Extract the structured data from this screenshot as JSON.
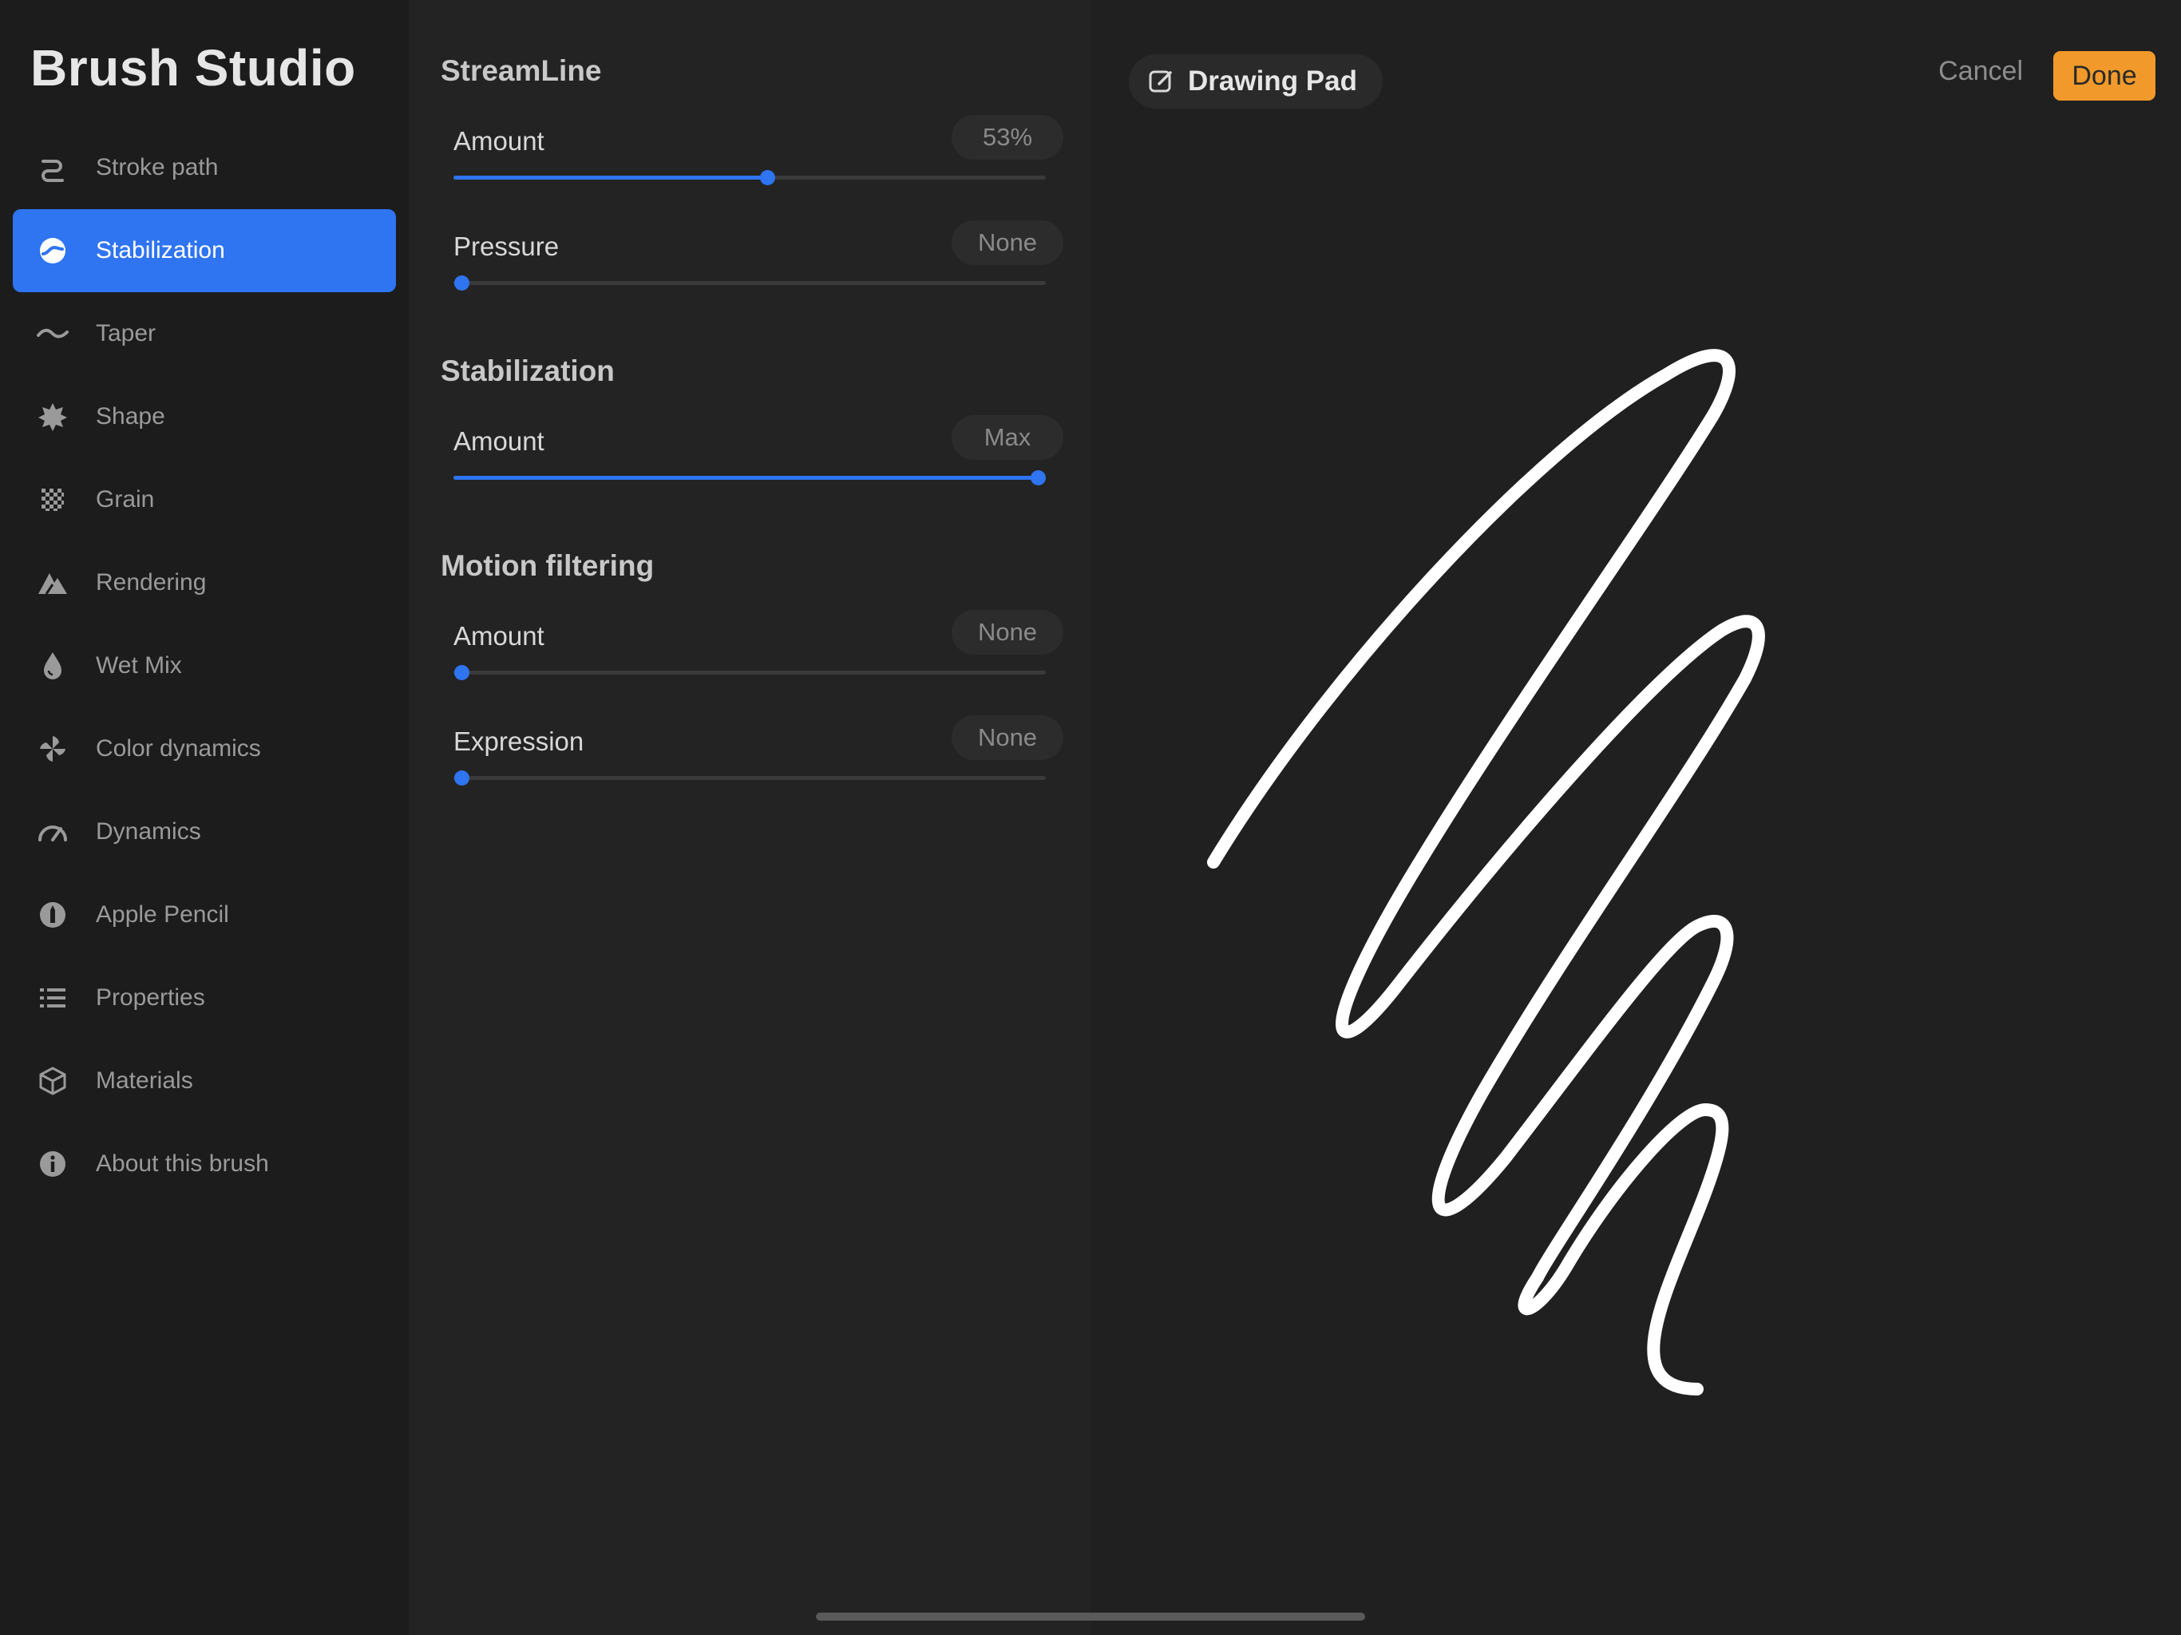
{
  "sidebar": {
    "title": "Brush Studio",
    "items": [
      {
        "label": "Stroke path",
        "icon": "stroke-path-icon",
        "active": false
      },
      {
        "label": "Stabilization",
        "icon": "stabilization-icon",
        "active": true
      },
      {
        "label": "Taper",
        "icon": "taper-icon",
        "active": false
      },
      {
        "label": "Shape",
        "icon": "shape-icon",
        "active": false
      },
      {
        "label": "Grain",
        "icon": "grain-icon",
        "active": false
      },
      {
        "label": "Rendering",
        "icon": "rendering-icon",
        "active": false
      },
      {
        "label": "Wet Mix",
        "icon": "wet-mix-icon",
        "active": false
      },
      {
        "label": "Color dynamics",
        "icon": "color-dynamics-icon",
        "active": false
      },
      {
        "label": "Dynamics",
        "icon": "dynamics-icon",
        "active": false
      },
      {
        "label": "Apple Pencil",
        "icon": "apple-pencil-icon",
        "active": false
      },
      {
        "label": "Properties",
        "icon": "properties-icon",
        "active": false
      },
      {
        "label": "Materials",
        "icon": "materials-icon",
        "active": false
      },
      {
        "label": "About this brush",
        "icon": "info-icon",
        "active": false
      }
    ]
  },
  "settings": {
    "streamline": {
      "title": "StreamLine",
      "amount": {
        "label": "Amount",
        "value": "53%",
        "fraction": 0.53
      },
      "pressure": {
        "label": "Pressure",
        "value": "None",
        "fraction": 0.0
      }
    },
    "stabilization": {
      "title": "Stabilization",
      "amount": {
        "label": "Amount",
        "value": "Max",
        "fraction": 1.0
      }
    },
    "motion": {
      "title": "Motion filtering",
      "amount": {
        "label": "Amount",
        "value": "None",
        "fraction": 0.0
      },
      "expression": {
        "label": "Expression",
        "value": "None",
        "fraction": 0.0
      }
    }
  },
  "pad": {
    "title": "Drawing Pad",
    "cancel": "Cancel",
    "done": "Done"
  },
  "colors": {
    "accent": "#2f74f0",
    "done": "#f19a2b"
  }
}
